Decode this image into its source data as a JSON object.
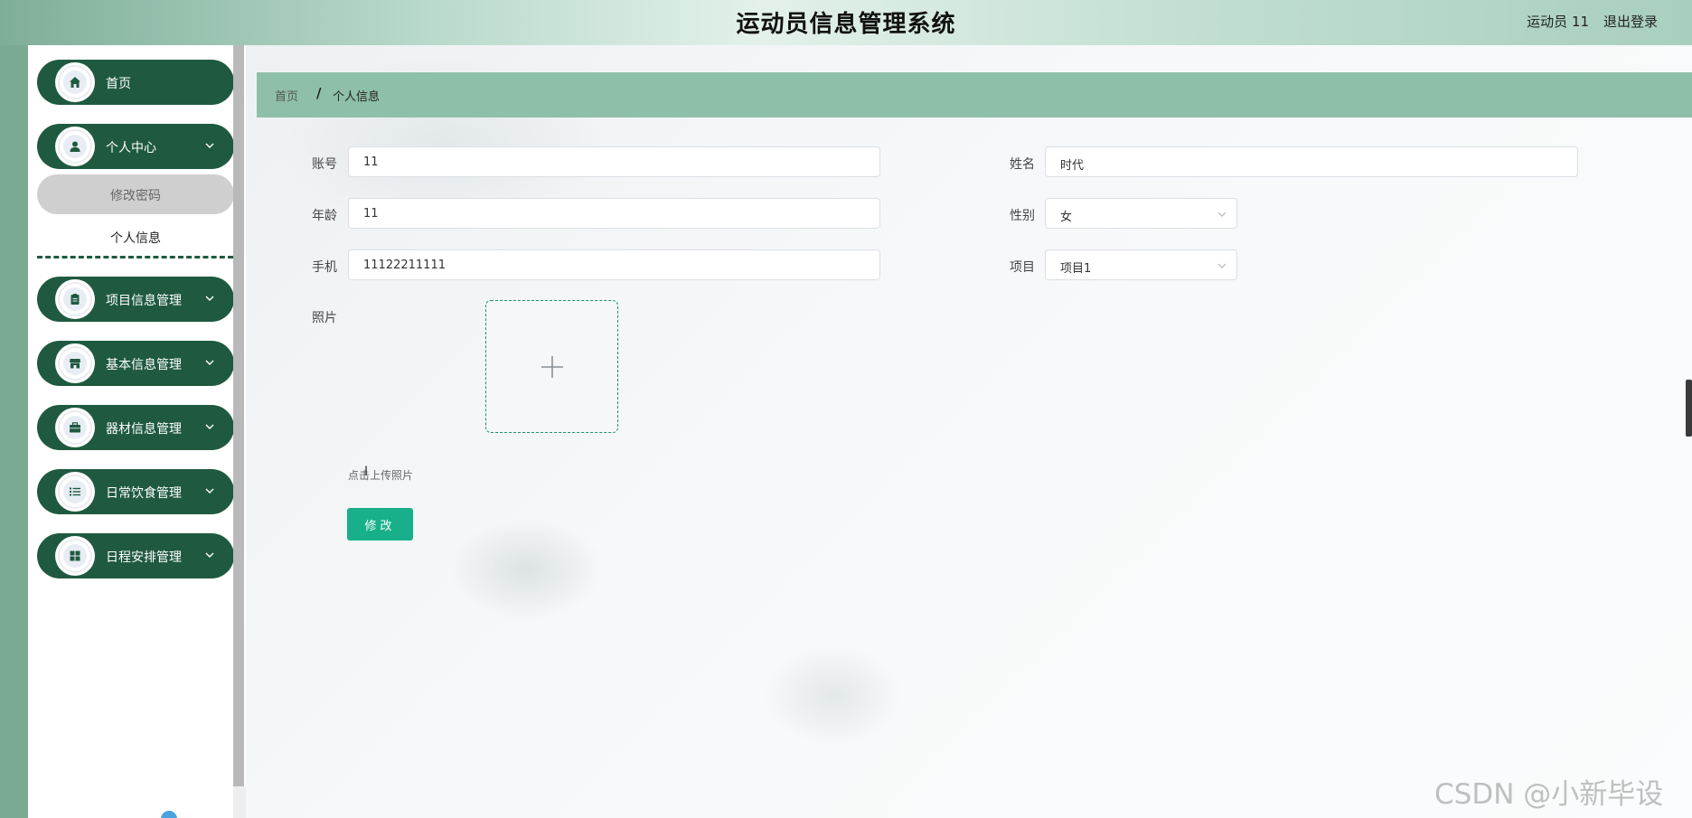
{
  "header": {
    "title": "运动员信息管理系统",
    "user_label": "运动员 11",
    "logout_label": "退出登录"
  },
  "sidebar": {
    "items": [
      {
        "label": "首页",
        "icon": "home-icon"
      },
      {
        "label": "个人中心",
        "icon": "user-icon",
        "expanded": true
      },
      {
        "label": "项目信息管理",
        "icon": "clipboard-icon"
      },
      {
        "label": "基本信息管理",
        "icon": "store-icon"
      },
      {
        "label": "器材信息管理",
        "icon": "briefcase-icon"
      },
      {
        "label": "日常饮食管理",
        "icon": "list-icon"
      },
      {
        "label": "日程安排管理",
        "icon": "grid-icon"
      }
    ],
    "submenu": {
      "change_password": "修改密码",
      "personal_info": "个人信息"
    }
  },
  "breadcrumb": {
    "home": "首页",
    "separator": "/",
    "current": "个人信息"
  },
  "form": {
    "account_label": "账号",
    "account_value": "11",
    "name_label": "姓名",
    "name_value": "时代",
    "age_label": "年龄",
    "age_value": "11",
    "gender_label": "性别",
    "gender_value": "女",
    "phone_label": "手机",
    "phone_value": "11122211111",
    "project_label": "项目",
    "project_value": "项目1",
    "photo_label": "照片",
    "upload_hint": "点击上传照片",
    "submit_label": "修改"
  },
  "watermark": "CSDN @小新毕设",
  "colors": {
    "sidebar_item": "#1f5a40",
    "breadcrumb_bg": "#8ebfa9",
    "primary_button": "#17b08a"
  }
}
